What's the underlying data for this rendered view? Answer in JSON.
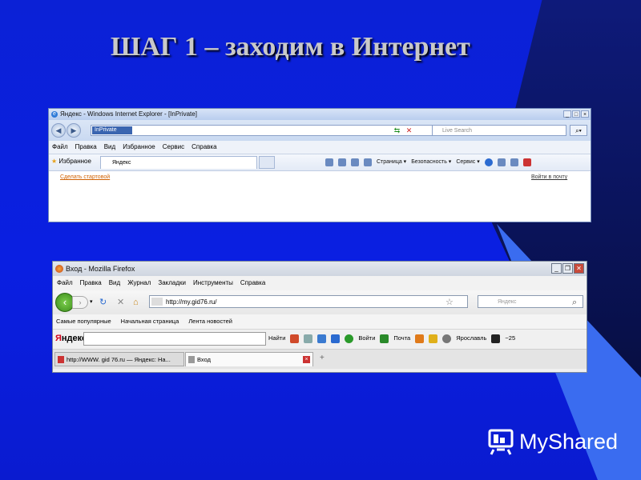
{
  "slide": {
    "title": "ШАГ 1 – заходим в Интернет"
  },
  "ie": {
    "title": "Яндекс - Windows Internet Explorer - [InPrivate]",
    "inprivate_badge": "InPrivate",
    "search_placeholder": "Live Search",
    "menu": [
      "Файл",
      "Правка",
      "Вид",
      "Избранное",
      "Сервис",
      "Справка"
    ],
    "favorites_label": "Избранное",
    "tab_label": "Яндекс",
    "command_bar": [
      "Страница ▾",
      "Безопасность ▾",
      "Сервис ▾"
    ],
    "content_link_left": "Сделать стартовой",
    "content_link_right": "Войти в почту"
  },
  "firefox": {
    "title": "Вход - Mozilla Firefox",
    "menu": [
      "Файл",
      "Правка",
      "Вид",
      "Журнал",
      "Закладки",
      "Инструменты",
      "Справка"
    ],
    "url": "http://my.gid76.ru/",
    "search_placeholder": "Яндекс",
    "bookmarks": [
      "Самые популярные",
      "Начальная страница",
      "Лента новостей"
    ],
    "yandex_bar": {
      "find": "Найти",
      "login": "Войти",
      "mail": "Почта",
      "city": "Ярославль",
      "temp": "−25"
    },
    "tabs": [
      "http://WWW. gid 76.ru — Яндекс: На...",
      "Вход"
    ]
  },
  "watermark": "MyShared",
  "colors": {
    "background": "#0a1fe2",
    "title_text": "#c9c9c9"
  }
}
